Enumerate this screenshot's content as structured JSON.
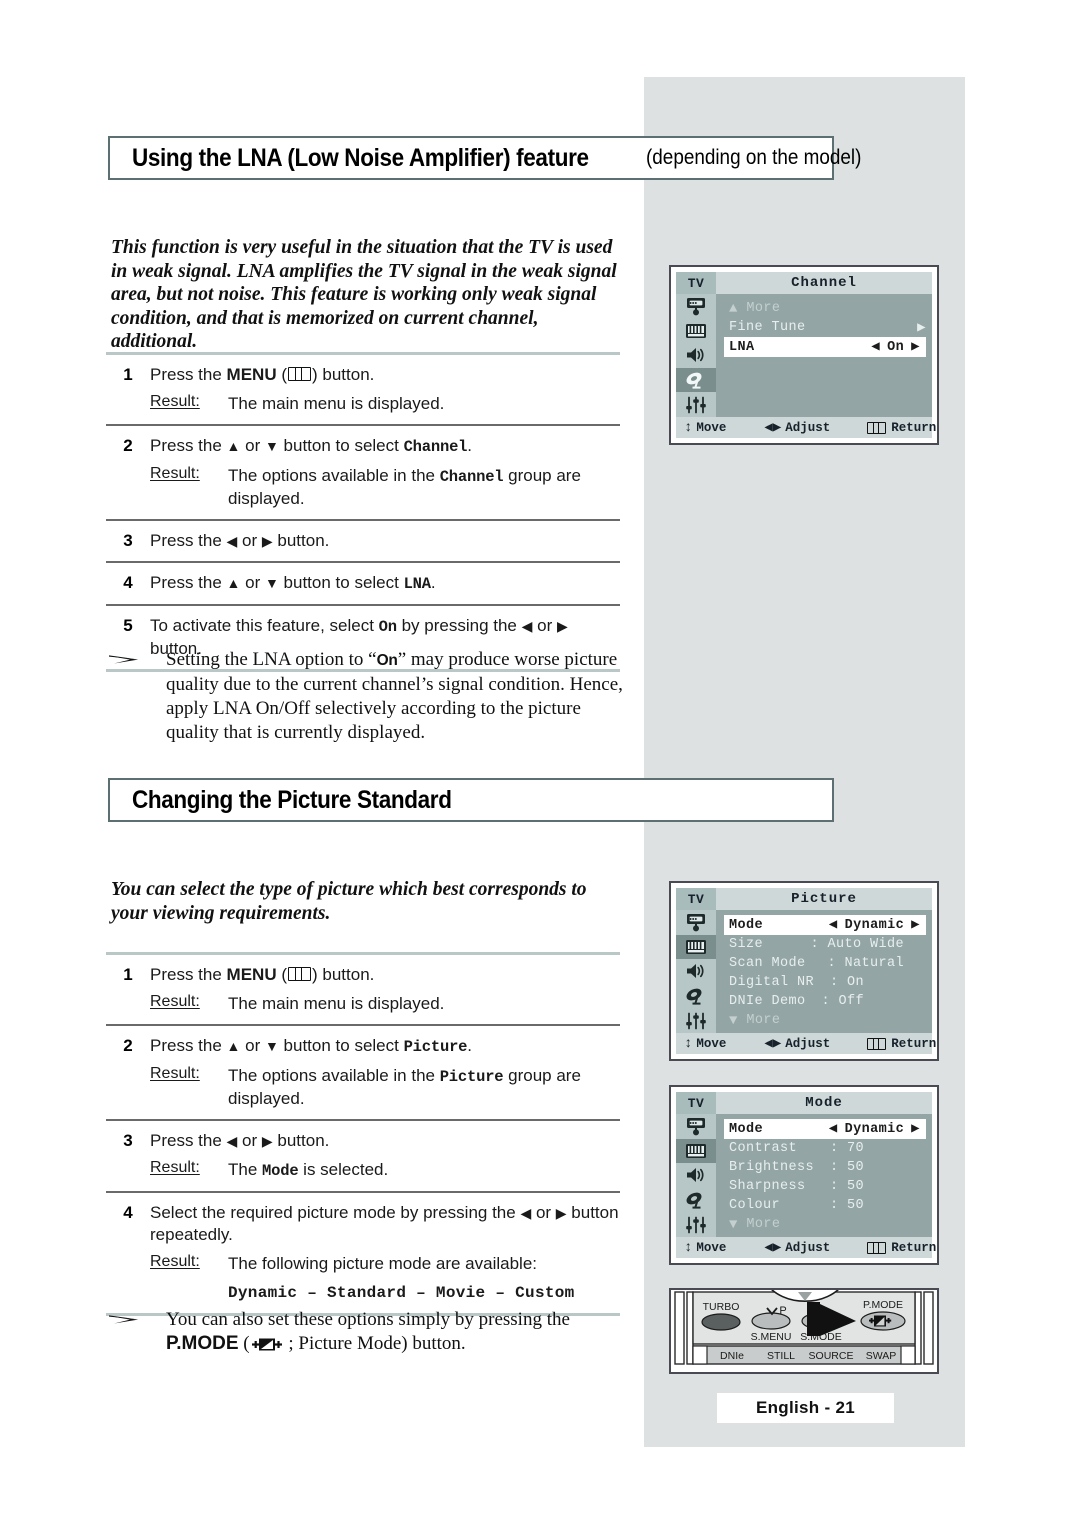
{
  "sections": [
    {
      "title_main": "Using the LNA (Low Noise Amplifier) feature",
      "title_sub": "(depending on the model)",
      "intro": "This function is very useful in the situation that the TV is used in weak signal. LNA amplifies the TV signal in the weak signal area, but not noise. This feature is working only weak signal condition, and that is memorized on current channel, additional."
    },
    {
      "title_main": "Changing the Picture Standard",
      "title_sub": "",
      "intro": "You can select the type of picture which best corresponds to your viewing requirements."
    }
  ],
  "steps_lna": {
    "s1_num": "1",
    "s1_text_a": "Press the ",
    "s1_text_b": "MENU",
    "s1_text_c": ") button.",
    "s1_result_label": "Result:",
    "s1_result_text": "The main menu is displayed.",
    "s2_num": "2",
    "s2_text_a": "Press the ",
    "s2_text_b": " or ",
    "s2_text_c": " button to select ",
    "s2_target": "Channel",
    "s2_text_d": ".",
    "s2_result_label": "Result:",
    "s2_result_a": "The options available in the ",
    "s2_result_target": "Channel",
    "s2_result_b": " group are displayed.",
    "s3_num": "3",
    "s3_text_a": "Press the ",
    "s3_text_b": " or ",
    "s3_text_c": " button.",
    "s4_num": "4",
    "s4_text_a": "Press the ",
    "s4_text_b": " or ",
    "s4_text_c": " button to select ",
    "s4_target": "LNA",
    "s4_text_d": ".",
    "s5_num": "5",
    "s5_text_a": "To activate this feature, select ",
    "s5_target": "On",
    "s5_text_b": " by pressing the ",
    "s5_text_c": " or ",
    "s5_text_d": " button."
  },
  "note_lna": {
    "text_a": "Setting the LNA option to “",
    "target": "On",
    "text_b": "” may produce worse picture quality due to the current channel’s signal condition. Hence, apply LNA On/Off selectively according to the picture quality that is currently displayed."
  },
  "steps_picture": {
    "s1_num": "1",
    "s1_text_a": "Press the ",
    "s1_text_b": "MENU",
    "s1_text_c": ") button.",
    "s1_result_label": "Result:",
    "s1_result_text": "The main menu is displayed.",
    "s2_num": "2",
    "s2_text_a": "Press the ",
    "s2_text_b": " or ",
    "s2_text_c": " button to select ",
    "s2_target": "Picture",
    "s2_text_d": ".",
    "s2_result_label": "Result:",
    "s2_result_a": "The options available in the ",
    "s2_result_target": "Picture",
    "s2_result_b": " group are displayed.",
    "s3_num": "3",
    "s3_text_a": "Press the ",
    "s3_text_b": " or ",
    "s3_text_c": " button.",
    "s3_result_label": "Result:",
    "s3_result_a": "The ",
    "s3_result_target": "Mode",
    "s3_result_b": " is selected.",
    "s4_num": "4",
    "s4_text_a": "Select the required picture mode by pressing the ",
    "s4_text_b": " or ",
    "s4_text_c": " button repeatedly.",
    "s4_result_label": "Result:",
    "s4_result_text": "The following picture mode are available:",
    "s4_modes": "Dynamic – Standard – Movie – Custom"
  },
  "note_picture": {
    "text_a": "You can also set these options simply by pressing the ",
    "bold_label": "P.MODE",
    "text_b": " ; Picture Mode) button."
  },
  "osd_channel": {
    "tv_label": "TV",
    "title": "Channel",
    "rows": [
      {
        "label": "More",
        "kind": "more-up"
      },
      {
        "label": "Fine Tune",
        "kind": "arrow-right"
      },
      {
        "label": "LNA",
        "value": "On",
        "kind": "highlight-adjust"
      }
    ],
    "footer": {
      "move": "Move",
      "adjust": "Adjust",
      "return": "Return"
    },
    "selected_rail_index": 3
  },
  "osd_picture": {
    "tv_label": "TV",
    "title": "Picture",
    "rows": [
      {
        "label": "Mode",
        "value": "Dynamic",
        "kind": "highlight-adjust"
      },
      {
        "label": "Size",
        "value": ": Auto Wide",
        "kind": "value"
      },
      {
        "label": "Scan Mode",
        "value": ": Natural",
        "kind": "value"
      },
      {
        "label": "Digital NR",
        "value": ": On",
        "kind": "value2"
      },
      {
        "label": "DNIe Demo",
        "value": ": Off",
        "kind": "value2"
      },
      {
        "label": "More",
        "kind": "more-down"
      }
    ],
    "footer": {
      "move": "Move",
      "adjust": "Adjust",
      "return": "Return"
    },
    "selected_rail_index": 1
  },
  "osd_mode": {
    "tv_label": "TV",
    "title": "Mode",
    "rows": [
      {
        "label": "Mode",
        "value": "Dynamic",
        "kind": "highlight-adjust"
      },
      {
        "label": "Contrast",
        "value": ": 70",
        "kind": "value"
      },
      {
        "label": "Brightness",
        "value": ": 50",
        "kind": "value"
      },
      {
        "label": "Sharpness",
        "value": ": 50",
        "kind": "value"
      },
      {
        "label": "Colour",
        "value": ": 50",
        "kind": "value"
      },
      {
        "label": "More",
        "kind": "more-down"
      }
    ],
    "footer": {
      "move": "Move",
      "adjust": "Adjust",
      "return": "Return"
    },
    "selected_rail_index": 1
  },
  "remote": {
    "turbo": "TURBO",
    "smenu": "S.MENU",
    "p_up": "P",
    "smode": "S.MODE",
    "pmode": "P.MODE",
    "bottom_row": [
      "DNIe",
      "STILL",
      "SOURCE",
      "SWAP"
    ]
  },
  "footer": {
    "page_label": "English - 21"
  },
  "colors": {
    "panel_bg": "#dde1e1",
    "osd_body": "#93a5a5",
    "osd_header": "#ced8d8",
    "osd_rail": "#b7c6c6",
    "osd_rail_sel": "#7b8e8e",
    "title_border": "#5c6f73",
    "rule": "#a8b8b8"
  }
}
